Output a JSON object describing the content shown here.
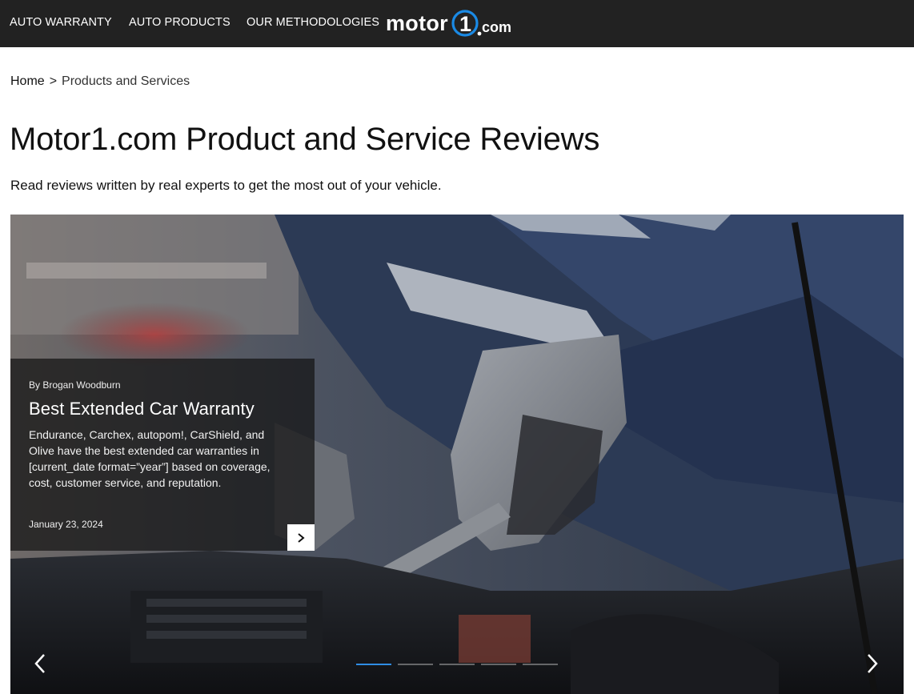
{
  "nav": {
    "items": [
      {
        "label": "AUTO WARRANTY"
      },
      {
        "label": "AUTO PRODUCTS"
      },
      {
        "label": "OUR METHODOLOGIES"
      }
    ],
    "logo_text": "motor1.com",
    "logo_accent": "#1a8ae5"
  },
  "breadcrumb": {
    "home": "Home",
    "separator": ">",
    "current": "Products and Services"
  },
  "page": {
    "title": "Motor1.com Product and Service Reviews",
    "subtitle": "Read reviews written by real experts to get the most out of your vehicle."
  },
  "hero": {
    "image": "mechanic-with-wrench-engine-photo",
    "card": {
      "author": "By Brogan Woodburn",
      "title": "Best Extended Car Warranty",
      "excerpt": "Endurance, Carchex, autopom!, CarShield, and Olive have the best extended car warranties in [current_date format=”year”] based on coverage, cost, customer service, and reputation.",
      "date": "January 23, 2024",
      "next_icon": "chevron-right-icon"
    },
    "prev_icon": "chevron-left-icon",
    "next_icon": "chevron-right-icon",
    "slides_total": 5,
    "active_slide": 1,
    "accent_color": "#2f8de4"
  }
}
